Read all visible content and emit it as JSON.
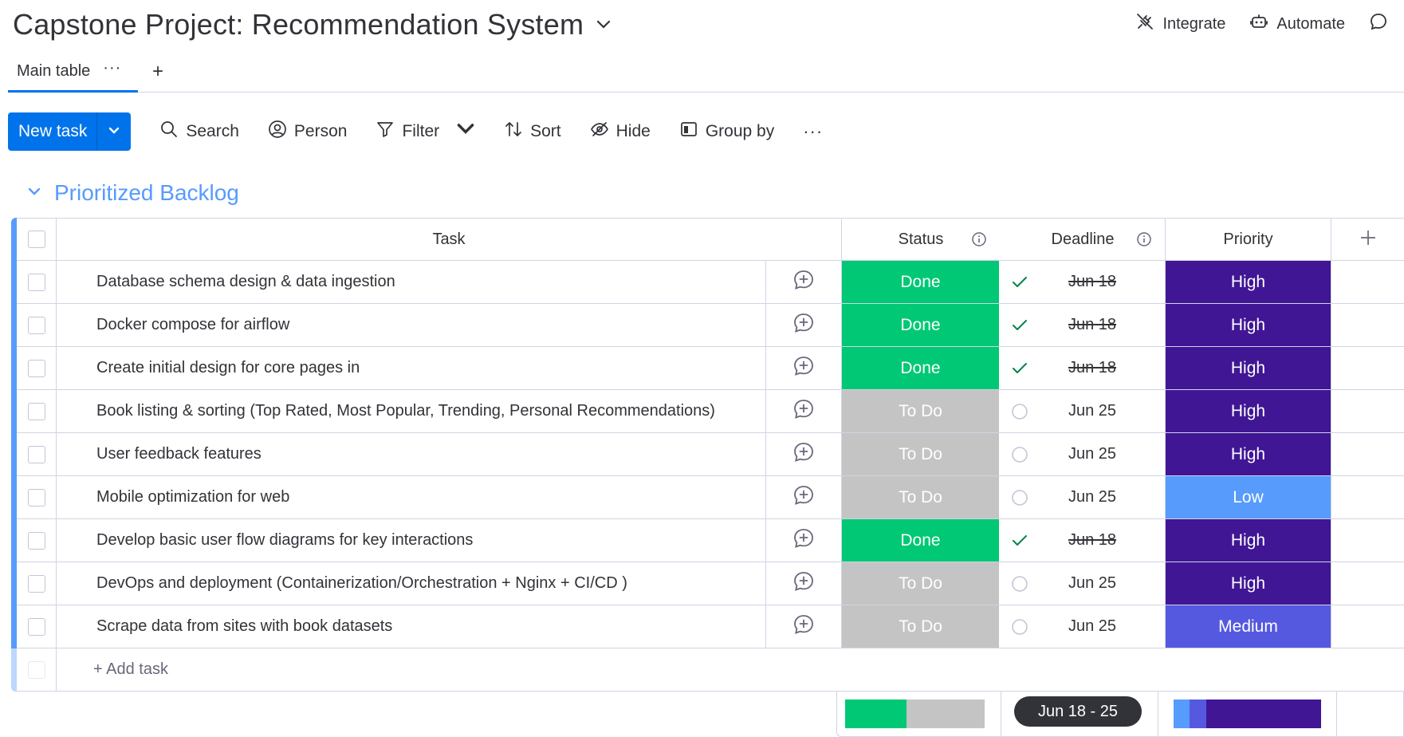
{
  "board": {
    "title": "Capstone Project: Recommendation System",
    "actions": [
      "Integrate",
      "Automate"
    ]
  },
  "tabs": {
    "main": "Main table",
    "dots": "···",
    "add": "+"
  },
  "toolbar": {
    "new_task": "New task",
    "search": "Search",
    "person": "Person",
    "filter": "Filter",
    "sort": "Sort",
    "hide": "Hide",
    "group_by": "Group by",
    "more": "···"
  },
  "group": {
    "title": "Prioritized Backlog",
    "color": "#579bfc"
  },
  "columns": {
    "task": "Task",
    "status": "Status",
    "deadline": "Deadline",
    "priority": "Priority"
  },
  "colors": {
    "done": "#00c875",
    "todo": "#c4c4c4",
    "high": "#401694",
    "low": "#579bfc",
    "medium": "#5559df",
    "check": "#00854d"
  },
  "rows": [
    {
      "task": "Database schema design & data ingestion",
      "status": "Done",
      "deadline": "Jun 18",
      "priority": "High"
    },
    {
      "task": "Docker compose for airflow",
      "status": "Done",
      "deadline": "Jun 18",
      "priority": "High"
    },
    {
      "task": "Create initial design for core pages in",
      "status": "Done",
      "deadline": "Jun 18",
      "priority": "High"
    },
    {
      "task": "Book listing & sorting (Top Rated, Most Popular, Trending, Personal Recommendations)",
      "status": "To Do",
      "deadline": "Jun 25",
      "priority": "High"
    },
    {
      "task": "User feedback features",
      "status": "To Do",
      "deadline": "Jun 25",
      "priority": "High"
    },
    {
      "task": "Mobile optimization for web",
      "status": "To Do",
      "deadline": "Jun 25",
      "priority": "Low"
    },
    {
      "task": "Develop basic user flow diagrams for key interactions",
      "status": "Done",
      "deadline": "Jun 18",
      "priority": "High"
    },
    {
      "task": "DevOps and deployment (Containerization/Orchestration + Nginx + CI/CD )",
      "status": "To Do",
      "deadline": "Jun 25",
      "priority": "High"
    },
    {
      "task": "Scrape data from sites with book datasets",
      "status": "To Do",
      "deadline": "Jun 25",
      "priority": "Medium"
    }
  ],
  "add_task": "+ Add task",
  "summary": {
    "date_range": "Jun 18 - 25",
    "status_done_fraction": 0.44,
    "priority_low_fraction": 0.11,
    "priority_medium_fraction": 0.11,
    "priority_high_fraction": 0.78
  }
}
